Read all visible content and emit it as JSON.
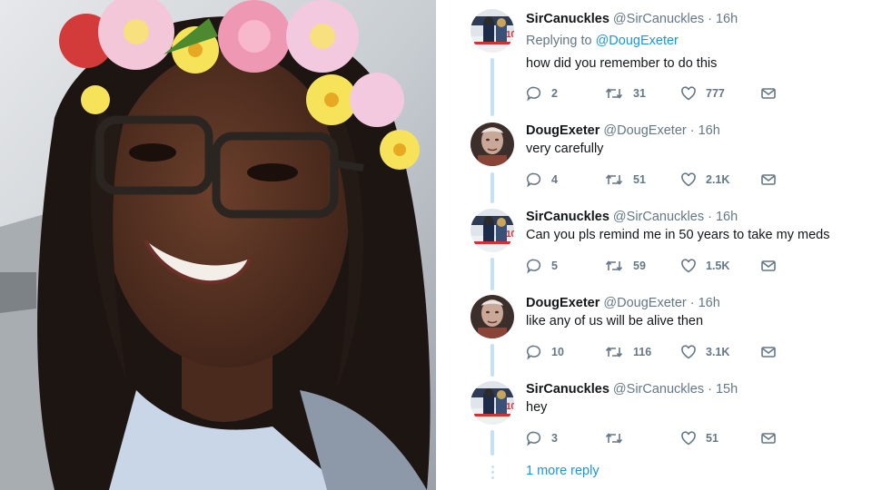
{
  "thread": {
    "tweets": [
      {
        "name": "SirCanuckles",
        "handle": "@SirCanuckles",
        "time": "· 16h",
        "replying_label": "Replying to",
        "replying_to": "@DougExeter",
        "text": "how did you remember to do this",
        "replies": "2",
        "retweets": "31",
        "likes": "777",
        "avatar": "hockey-avatar"
      },
      {
        "name": "DougExeter",
        "handle": "@DougExeter",
        "time": "· 16h",
        "text": "very carefully",
        "replies": "4",
        "retweets": "51",
        "likes": "2.1K",
        "avatar": "old-man-avatar"
      },
      {
        "name": "SirCanuckles",
        "handle": "@SirCanuckles",
        "time": "· 16h",
        "text": "Can you pls remind me in 50 years to take my meds",
        "replies": "5",
        "retweets": "59",
        "likes": "1.5K",
        "avatar": "hockey-avatar"
      },
      {
        "name": "DougExeter",
        "handle": "@DougExeter",
        "time": "· 16h",
        "text": "like any of us will be alive then",
        "replies": "10",
        "retweets": "116",
        "likes": "3.1K",
        "avatar": "old-man-avatar"
      },
      {
        "name": "SirCanuckles",
        "handle": "@SirCanuckles",
        "time": "· 15h",
        "text": "hey",
        "replies": "3",
        "retweets": "",
        "likes": "51",
        "avatar": "hockey-avatar"
      }
    ],
    "more_replies": "1 more reply"
  },
  "colors": {
    "link": "#1b95e0",
    "secondary": "#657786",
    "thread_line": "#c4e1f5",
    "text": "#14171a"
  },
  "icons": [
    "reply-icon",
    "retweet-icon",
    "like-icon",
    "message-icon"
  ]
}
